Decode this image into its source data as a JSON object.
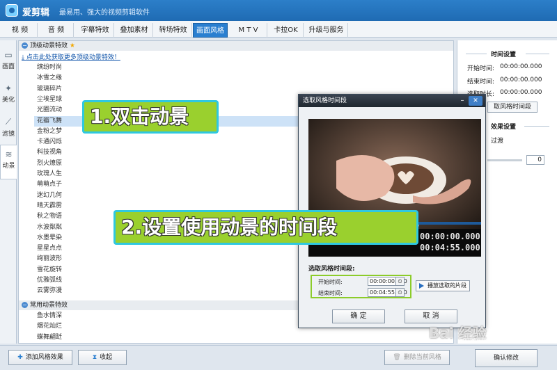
{
  "app": {
    "name": "爱剪辑",
    "slogan": "最易用、强大的视频剪辑软件"
  },
  "tabs": [
    "视 频",
    "音 频",
    "字幕特效",
    "叠加素材",
    "转场特效",
    "画面风格",
    "M T V",
    "卡拉OK",
    "升级与服务"
  ],
  "active_tab": "画面风格",
  "side_tabs": [
    "画面",
    "美化",
    "滤镜",
    "动景"
  ],
  "list": {
    "group1": "顶级动景特效",
    "download_link": "点击此处获取更多顶级动景特效！",
    "items1": [
      "缤纷时尚",
      "冰雪之缘",
      "玻璃碎片",
      "尘埃星球",
      "光圈流动",
      "花瓣飞舞",
      "金粉之梦",
      "卡通闪烁",
      "科技视角",
      "烈火燎原",
      "玫瑰人生",
      "萌萌点子",
      "迷幻几何",
      "晴天霹雳",
      "秋之物语",
      "水波粼粼",
      "水墨晕染",
      "星星点点",
      "绚丽波形",
      "雪花旋转",
      "优雅弧线",
      "云雾弥漫"
    ],
    "group2": "常用动景特效",
    "items2": [
      "鱼水情深",
      "烟花灿烂",
      "蝶舞翩跹"
    ],
    "selected": "花瓣飞舞"
  },
  "right_panel": {
    "time_header": "时间设置",
    "start_label": "开始时间:",
    "start_value": "00:00:00.000",
    "end_label": "结束时间:",
    "end_value": "00:00:00.000",
    "duration_label": "选取时长:",
    "duration_value": "00:00:00.000",
    "pick_button": "取风格时间段",
    "effect_header": "效果设置",
    "fade_label": "过渡",
    "slider_value": "0"
  },
  "bottom": {
    "add": "添加风格效果",
    "collapse": "收起",
    "delete": "删除当前风格",
    "confirm": "确认修改"
  },
  "dialog": {
    "title": "选取风格时间段",
    "time_display_top": "00:00:00.000",
    "time_display_bottom": "00:04:55.000",
    "section": "选取风格时间段:",
    "start_label": "开始时间:",
    "start_value": "00:00:00.000",
    "end_label": "结束时间:",
    "end_value": "00:04:55.000",
    "play_button": "播放选取的片段",
    "ok": "确 定",
    "cancel": "取 消"
  },
  "annotations": {
    "step1": "1.双击动景",
    "step2": "2.设置使用动景的时间段"
  },
  "watermark": {
    "text": "Bai 经验",
    "sub": "jingyan.baidu.com"
  }
}
